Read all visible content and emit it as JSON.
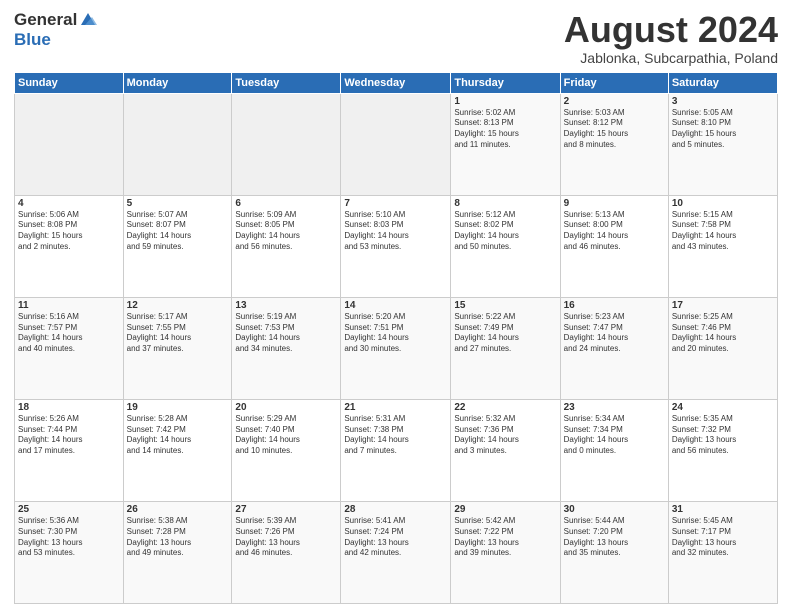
{
  "header": {
    "logo_general": "General",
    "logo_blue": "Blue",
    "month_title": "August 2024",
    "location": "Jablonka, Subcarpathia, Poland"
  },
  "weekdays": [
    "Sunday",
    "Monday",
    "Tuesday",
    "Wednesday",
    "Thursday",
    "Friday",
    "Saturday"
  ],
  "weeks": [
    [
      {
        "day": "",
        "info": ""
      },
      {
        "day": "",
        "info": ""
      },
      {
        "day": "",
        "info": ""
      },
      {
        "day": "",
        "info": ""
      },
      {
        "day": "1",
        "info": "Sunrise: 5:02 AM\nSunset: 8:13 PM\nDaylight: 15 hours\nand 11 minutes."
      },
      {
        "day": "2",
        "info": "Sunrise: 5:03 AM\nSunset: 8:12 PM\nDaylight: 15 hours\nand 8 minutes."
      },
      {
        "day": "3",
        "info": "Sunrise: 5:05 AM\nSunset: 8:10 PM\nDaylight: 15 hours\nand 5 minutes."
      }
    ],
    [
      {
        "day": "4",
        "info": "Sunrise: 5:06 AM\nSunset: 8:08 PM\nDaylight: 15 hours\nand 2 minutes."
      },
      {
        "day": "5",
        "info": "Sunrise: 5:07 AM\nSunset: 8:07 PM\nDaylight: 14 hours\nand 59 minutes."
      },
      {
        "day": "6",
        "info": "Sunrise: 5:09 AM\nSunset: 8:05 PM\nDaylight: 14 hours\nand 56 minutes."
      },
      {
        "day": "7",
        "info": "Sunrise: 5:10 AM\nSunset: 8:03 PM\nDaylight: 14 hours\nand 53 minutes."
      },
      {
        "day": "8",
        "info": "Sunrise: 5:12 AM\nSunset: 8:02 PM\nDaylight: 14 hours\nand 50 minutes."
      },
      {
        "day": "9",
        "info": "Sunrise: 5:13 AM\nSunset: 8:00 PM\nDaylight: 14 hours\nand 46 minutes."
      },
      {
        "day": "10",
        "info": "Sunrise: 5:15 AM\nSunset: 7:58 PM\nDaylight: 14 hours\nand 43 minutes."
      }
    ],
    [
      {
        "day": "11",
        "info": "Sunrise: 5:16 AM\nSunset: 7:57 PM\nDaylight: 14 hours\nand 40 minutes."
      },
      {
        "day": "12",
        "info": "Sunrise: 5:17 AM\nSunset: 7:55 PM\nDaylight: 14 hours\nand 37 minutes."
      },
      {
        "day": "13",
        "info": "Sunrise: 5:19 AM\nSunset: 7:53 PM\nDaylight: 14 hours\nand 34 minutes."
      },
      {
        "day": "14",
        "info": "Sunrise: 5:20 AM\nSunset: 7:51 PM\nDaylight: 14 hours\nand 30 minutes."
      },
      {
        "day": "15",
        "info": "Sunrise: 5:22 AM\nSunset: 7:49 PM\nDaylight: 14 hours\nand 27 minutes."
      },
      {
        "day": "16",
        "info": "Sunrise: 5:23 AM\nSunset: 7:47 PM\nDaylight: 14 hours\nand 24 minutes."
      },
      {
        "day": "17",
        "info": "Sunrise: 5:25 AM\nSunset: 7:46 PM\nDaylight: 14 hours\nand 20 minutes."
      }
    ],
    [
      {
        "day": "18",
        "info": "Sunrise: 5:26 AM\nSunset: 7:44 PM\nDaylight: 14 hours\nand 17 minutes."
      },
      {
        "day": "19",
        "info": "Sunrise: 5:28 AM\nSunset: 7:42 PM\nDaylight: 14 hours\nand 14 minutes."
      },
      {
        "day": "20",
        "info": "Sunrise: 5:29 AM\nSunset: 7:40 PM\nDaylight: 14 hours\nand 10 minutes."
      },
      {
        "day": "21",
        "info": "Sunrise: 5:31 AM\nSunset: 7:38 PM\nDaylight: 14 hours\nand 7 minutes."
      },
      {
        "day": "22",
        "info": "Sunrise: 5:32 AM\nSunset: 7:36 PM\nDaylight: 14 hours\nand 3 minutes."
      },
      {
        "day": "23",
        "info": "Sunrise: 5:34 AM\nSunset: 7:34 PM\nDaylight: 14 hours\nand 0 minutes."
      },
      {
        "day": "24",
        "info": "Sunrise: 5:35 AM\nSunset: 7:32 PM\nDaylight: 13 hours\nand 56 minutes."
      }
    ],
    [
      {
        "day": "25",
        "info": "Sunrise: 5:36 AM\nSunset: 7:30 PM\nDaylight: 13 hours\nand 53 minutes."
      },
      {
        "day": "26",
        "info": "Sunrise: 5:38 AM\nSunset: 7:28 PM\nDaylight: 13 hours\nand 49 minutes."
      },
      {
        "day": "27",
        "info": "Sunrise: 5:39 AM\nSunset: 7:26 PM\nDaylight: 13 hours\nand 46 minutes."
      },
      {
        "day": "28",
        "info": "Sunrise: 5:41 AM\nSunset: 7:24 PM\nDaylight: 13 hours\nand 42 minutes."
      },
      {
        "day": "29",
        "info": "Sunrise: 5:42 AM\nSunset: 7:22 PM\nDaylight: 13 hours\nand 39 minutes."
      },
      {
        "day": "30",
        "info": "Sunrise: 5:44 AM\nSunset: 7:20 PM\nDaylight: 13 hours\nand 35 minutes."
      },
      {
        "day": "31",
        "info": "Sunrise: 5:45 AM\nSunset: 7:17 PM\nDaylight: 13 hours\nand 32 minutes."
      }
    ]
  ]
}
